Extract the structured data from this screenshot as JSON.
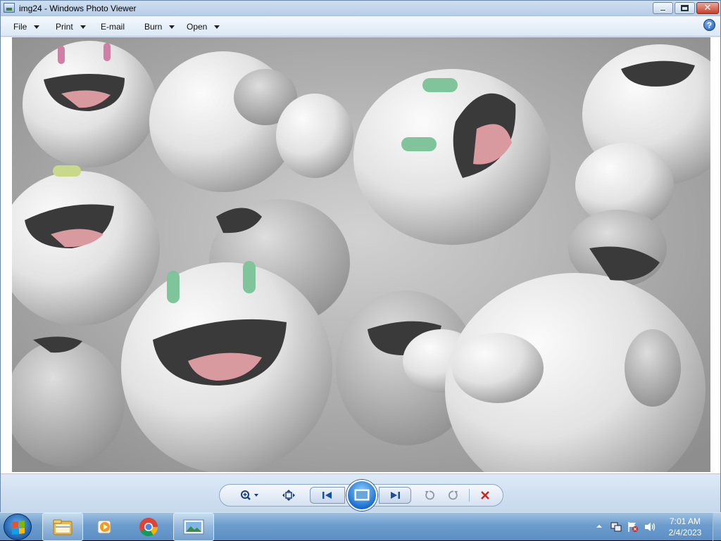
{
  "window": {
    "title": "img24 - Windows Photo Viewer",
    "icon": "photo-viewer-icon"
  },
  "menu": {
    "items": [
      {
        "label": "File",
        "has_dropdown": true
      },
      {
        "label": "Print",
        "has_dropdown": true
      },
      {
        "label": "E-mail",
        "has_dropdown": false
      },
      {
        "label": "Burn",
        "has_dropdown": true
      },
      {
        "label": "Open",
        "has_dropdown": true
      }
    ],
    "help_icon": "help-icon"
  },
  "photo": {
    "description_icon": "image-content",
    "colors": {
      "figure": "#e9e9e9",
      "mouth": "#3a3a3a",
      "tongue": "#d8999f",
      "eye_green": "#7fc49a",
      "eye_pink": "#cf7fa4",
      "background": "#bcbcbc"
    }
  },
  "controls": {
    "icons": [
      "zoom-icon",
      "fit-window-icon",
      "previous-icon",
      "slideshow-icon",
      "next-icon",
      "rotate-left-icon",
      "rotate-right-icon",
      "delete-icon"
    ]
  },
  "taskbar": {
    "apps": [
      "start-orb",
      "windows-explorer-icon",
      "windows-media-player-icon",
      "chrome-icon",
      "photo-viewer-icon"
    ],
    "clock": {
      "time": "7:01 AM",
      "date": "2/4/2023"
    },
    "accent_color": "#5c8fc6"
  }
}
